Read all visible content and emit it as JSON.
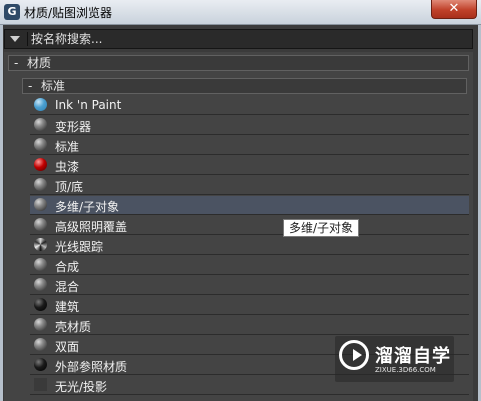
{
  "window": {
    "title": "材质/贴图浏览器",
    "close_label": "✕"
  },
  "search": {
    "placeholder": "按名称搜索..."
  },
  "groups": {
    "material": {
      "sign": "-",
      "label": "材质"
    },
    "standard": {
      "sign": "-",
      "label": "标准"
    }
  },
  "items": [
    {
      "label": "Ink 'n Paint",
      "icon": "blue-sphere-icon"
    },
    {
      "label": "变形器",
      "icon": "gray-sphere-icon"
    },
    {
      "label": "标准",
      "icon": "gray-sphere-icon"
    },
    {
      "label": "虫漆",
      "icon": "red-sphere-icon"
    },
    {
      "label": "顶/底",
      "icon": "gray-sphere-icon"
    },
    {
      "label": "多维/子对象",
      "icon": "gray-sphere-icon"
    },
    {
      "label": "高级照明覆盖",
      "icon": "gray-sphere-icon"
    },
    {
      "label": "光线跟踪",
      "icon": "swirl-sphere-icon"
    },
    {
      "label": "合成",
      "icon": "gray-sphere-icon"
    },
    {
      "label": "混合",
      "icon": "gray-sphere-icon"
    },
    {
      "label": "建筑",
      "icon": "dark-sphere-icon"
    },
    {
      "label": "壳材质",
      "icon": "gray-sphere-icon"
    },
    {
      "label": "双面",
      "icon": "gray-sphere-icon"
    },
    {
      "label": "外部参照材质",
      "icon": "dark-sphere-icon"
    },
    {
      "label": "无光/投影",
      "icon": "none"
    }
  ],
  "tooltip": {
    "text": "多维/子对象"
  },
  "watermark": {
    "title": "溜溜自学",
    "url": "ZIXUE.3D66.COM"
  },
  "colors": {
    "highlight": "#4b5362",
    "background": "#444444"
  }
}
